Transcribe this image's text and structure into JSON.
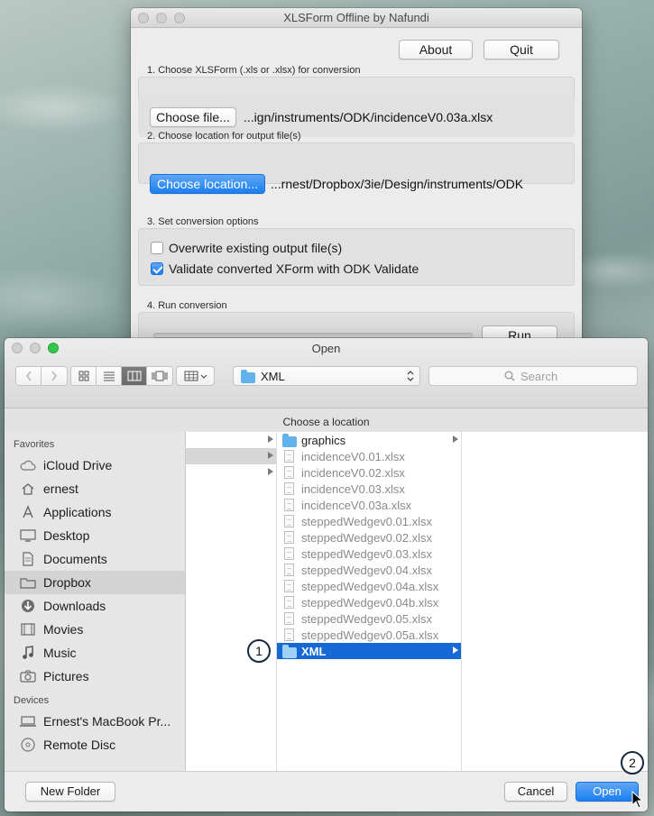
{
  "xls_window": {
    "title": "XLSForm Offline by Nafundi",
    "about_label": "About",
    "quit_label": "Quit",
    "step1_label": "1. Choose XLSForm (.xls or .xlsx) for conversion",
    "choose_file_label": "Choose file...",
    "file_path": "...ign/instruments/ODK/incidenceV0.03a.xlsx",
    "step2_label": "2. Choose location for output file(s)",
    "choose_location_label": "Choose location...",
    "location_path": "...rnest/Dropbox/3ie/Design/instruments/ODK",
    "step3_label": "3. Set conversion options",
    "option_overwrite": "Overwrite existing output file(s)",
    "option_overwrite_checked": false,
    "option_validate": "Validate converted XForm with ODK Validate",
    "option_validate_checked": true,
    "step4_label": "4. Run conversion",
    "run_label": "Run",
    "progress": 0
  },
  "open_dialog": {
    "title": "Open",
    "current_folder": "XML",
    "search_placeholder": "Search",
    "location_prompt": "Choose a location",
    "sidebar": {
      "favorites_heading": "Favorites",
      "favorites": [
        {
          "label": "iCloud Drive",
          "icon": "cloud-icon"
        },
        {
          "label": "ernest",
          "icon": "home-icon"
        },
        {
          "label": "Applications",
          "icon": "applications-icon"
        },
        {
          "label": "Desktop",
          "icon": "desktop-icon"
        },
        {
          "label": "Documents",
          "icon": "documents-icon"
        },
        {
          "label": "Dropbox",
          "icon": "folder-icon",
          "selected": true
        },
        {
          "label": "Downloads",
          "icon": "download-icon"
        },
        {
          "label": "Movies",
          "icon": "film-icon"
        },
        {
          "label": "Music",
          "icon": "music-note-icon"
        },
        {
          "label": "Pictures",
          "icon": "camera-icon"
        }
      ],
      "devices_heading": "Devices",
      "devices": [
        {
          "label": "Ernest's MacBook Pr...",
          "icon": "laptop-icon"
        },
        {
          "label": "Remote Disc",
          "icon": "disc-icon"
        }
      ]
    },
    "files": [
      {
        "name": "graphics",
        "type": "folder"
      },
      {
        "name": "incidenceV0.01.xlsx",
        "type": "file"
      },
      {
        "name": "incidenceV0.02.xlsx",
        "type": "file"
      },
      {
        "name": "incidenceV0.03.xlsx",
        "type": "file"
      },
      {
        "name": "incidenceV0.03a.xlsx",
        "type": "file"
      },
      {
        "name": "steppedWedgev0.01.xlsx",
        "type": "file"
      },
      {
        "name": "steppedWedgev0.02.xlsx",
        "type": "file"
      },
      {
        "name": "steppedWedgev0.03.xlsx",
        "type": "file"
      },
      {
        "name": "steppedWedgev0.04.xlsx",
        "type": "file"
      },
      {
        "name": "steppedWedgev0.04a.xlsx",
        "type": "file"
      },
      {
        "name": "steppedWedgev0.04b.xlsx",
        "type": "file"
      },
      {
        "name": "steppedWedgev0.05.xlsx",
        "type": "file"
      },
      {
        "name": "steppedWedgev0.05a.xlsx",
        "type": "file"
      },
      {
        "name": "XML",
        "type": "folder",
        "selected": true
      }
    ],
    "new_folder_label": "New Folder",
    "cancel_label": "Cancel",
    "open_label": "Open"
  },
  "annotations": {
    "step_1": "1",
    "step_2": "2"
  },
  "colors": {
    "accent_blue": "#1668d5",
    "folder_blue": "#62b3ec"
  }
}
